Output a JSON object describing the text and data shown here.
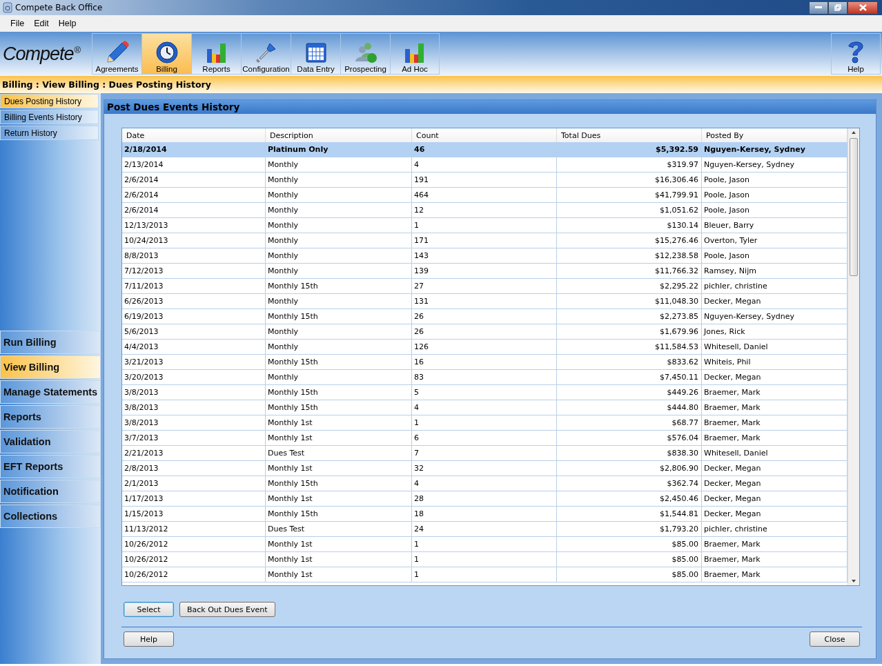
{
  "window": {
    "title": "Compete Back Office"
  },
  "menu": [
    "File",
    "Edit",
    "Help"
  ],
  "logo": {
    "text": "Compete",
    "mark": "®"
  },
  "toolbar": [
    {
      "label": "Agreements",
      "kind": "pencil",
      "selected": false
    },
    {
      "label": "Billing",
      "kind": "clock",
      "selected": true
    },
    {
      "label": "Reports",
      "kind": "chart",
      "selected": false
    },
    {
      "label": "Configuration",
      "kind": "screwdriver",
      "selected": false
    },
    {
      "label": "Data Entry",
      "kind": "calendar",
      "selected": false
    },
    {
      "label": "Prospecting",
      "kind": "people",
      "selected": false
    },
    {
      "label": "Ad Hoc",
      "kind": "chart",
      "selected": false
    }
  ],
  "help_button": {
    "label": "Help"
  },
  "breadcrumb": "Billing : View Billing : Dues Posting History",
  "subnav": [
    {
      "label": "Dues Posting History",
      "selected": true
    },
    {
      "label": "Billing Events History",
      "selected": false
    },
    {
      "label": "Return History",
      "selected": false
    }
  ],
  "nav": [
    {
      "label": "Run Billing",
      "selected": false
    },
    {
      "label": "View Billing",
      "selected": true
    },
    {
      "label": "Manage Statements",
      "selected": false
    },
    {
      "label": "Reports",
      "selected": false
    },
    {
      "label": "Validation",
      "selected": false
    },
    {
      "label": "EFT Reports",
      "selected": false
    },
    {
      "label": "Notification",
      "selected": false
    },
    {
      "label": "Collections",
      "selected": false
    }
  ],
  "panel": {
    "title": "Post Dues Events History",
    "table": {
      "columns": [
        "Date",
        "Description",
        "Count",
        "Total Dues",
        "Posted By"
      ],
      "rows": [
        {
          "cells": [
            "2/18/2014",
            "Platinum Only",
            "46",
            "$5,392.59",
            "Nguyen-Kersey, Sydney"
          ],
          "selected": true
        },
        {
          "cells": [
            "2/13/2014",
            "Monthly",
            "4",
            "$319.97",
            "Nguyen-Kersey, Sydney"
          ],
          "selected": false
        },
        {
          "cells": [
            "2/6/2014",
            "Monthly",
            "191",
            "$16,306.46",
            "Poole, Jason"
          ],
          "selected": false
        },
        {
          "cells": [
            "2/6/2014",
            "Monthly",
            "464",
            "$41,799.91",
            "Poole, Jason"
          ],
          "selected": false
        },
        {
          "cells": [
            "2/6/2014",
            "Monthly",
            "12",
            "$1,051.62",
            "Poole, Jason"
          ],
          "selected": false
        },
        {
          "cells": [
            "12/13/2013",
            "Monthly",
            "1",
            "$130.14",
            "Bleuer, Barry"
          ],
          "selected": false
        },
        {
          "cells": [
            "10/24/2013",
            "Monthly",
            "171",
            "$15,276.46",
            "Overton, Tyler"
          ],
          "selected": false
        },
        {
          "cells": [
            "8/8/2013",
            "Monthly",
            "143",
            "$12,238.58",
            "Poole, Jason"
          ],
          "selected": false
        },
        {
          "cells": [
            "7/12/2013",
            "Monthly",
            "139",
            "$11,766.32",
            "Ramsey, Nijm"
          ],
          "selected": false
        },
        {
          "cells": [
            "7/11/2013",
            "Monthly 15th",
            "27",
            "$2,295.22",
            "pichler, christine"
          ],
          "selected": false
        },
        {
          "cells": [
            "6/26/2013",
            "Monthly",
            "131",
            "$11,048.30",
            "Decker, Megan"
          ],
          "selected": false
        },
        {
          "cells": [
            "6/19/2013",
            "Monthly 15th",
            "26",
            "$2,273.85",
            "Nguyen-Kersey, Sydney"
          ],
          "selected": false
        },
        {
          "cells": [
            "5/6/2013",
            "Monthly",
            "26",
            "$1,679.96",
            "Jones, Rick"
          ],
          "selected": false
        },
        {
          "cells": [
            "4/4/2013",
            "Monthly",
            "126",
            "$11,584.53",
            "Whitesell, Daniel"
          ],
          "selected": false
        },
        {
          "cells": [
            "3/21/2013",
            "Monthly 15th",
            "16",
            "$833.62",
            "Whiteis, Phil"
          ],
          "selected": false
        },
        {
          "cells": [
            "3/20/2013",
            "Monthly",
            "83",
            "$7,450.11",
            "Decker, Megan"
          ],
          "selected": false
        },
        {
          "cells": [
            "3/8/2013",
            "Monthly 15th",
            "5",
            "$449.26",
            "Braemer, Mark"
          ],
          "selected": false
        },
        {
          "cells": [
            "3/8/2013",
            "Monthly 15th",
            "4",
            "$444.80",
            "Braemer, Mark"
          ],
          "selected": false
        },
        {
          "cells": [
            "3/8/2013",
            "Monthly 1st",
            "1",
            "$68.77",
            "Braemer, Mark"
          ],
          "selected": false
        },
        {
          "cells": [
            "3/7/2013",
            "Monthly 1st",
            "6",
            "$576.04",
            "Braemer, Mark"
          ],
          "selected": false
        },
        {
          "cells": [
            "2/21/2013",
            "Dues Test",
            "7",
            "$838.30",
            "Whitesell, Daniel"
          ],
          "selected": false
        },
        {
          "cells": [
            "2/8/2013",
            "Monthly 1st",
            "32",
            "$2,806.90",
            "Decker, Megan"
          ],
          "selected": false
        },
        {
          "cells": [
            "2/1/2013",
            "Monthly 15th",
            "4",
            "$362.74",
            "Decker, Megan"
          ],
          "selected": false
        },
        {
          "cells": [
            "1/17/2013",
            "Monthly 1st",
            "28",
            "$2,450.46",
            "Decker, Megan"
          ],
          "selected": false
        },
        {
          "cells": [
            "1/15/2013",
            "Monthly 15th",
            "18",
            "$1,544.81",
            "Decker, Megan"
          ],
          "selected": false
        },
        {
          "cells": [
            "11/13/2012",
            "Dues Test",
            "24",
            "$1,793.20",
            "pichler, christine"
          ],
          "selected": false
        },
        {
          "cells": [
            "10/26/2012",
            "Monthly 1st",
            "1",
            "$85.00",
            "Braemer, Mark"
          ],
          "selected": false
        },
        {
          "cells": [
            "10/26/2012",
            "Monthly 1st",
            "1",
            "$85.00",
            "Braemer, Mark"
          ],
          "selected": false
        },
        {
          "cells": [
            "10/26/2012",
            "Monthly 1st",
            "1",
            "$85.00",
            "Braemer, Mark"
          ],
          "selected": false
        }
      ]
    },
    "actions": [
      {
        "label": "Select",
        "focused": true
      },
      {
        "label": "Back Out Dues Event",
        "focused": false
      }
    ],
    "footer_buttons": [
      "Help",
      "Close"
    ]
  }
}
